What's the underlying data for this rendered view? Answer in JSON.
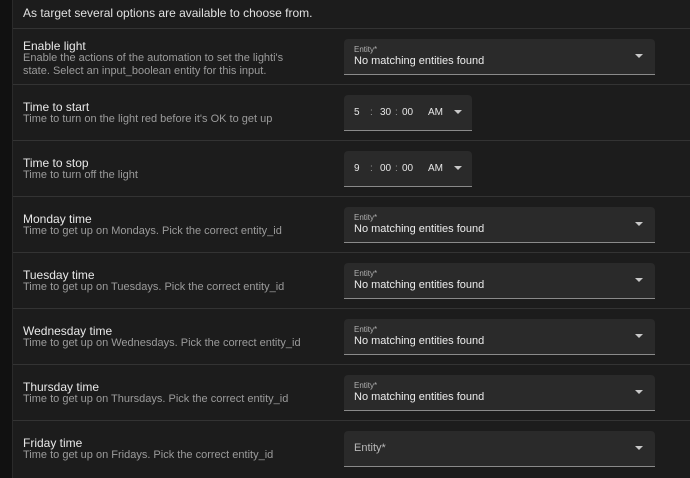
{
  "intro_text": "As target several options are available to choose from.",
  "rows": [
    {
      "title": "Enable light",
      "desc": "Enable the actions of the automation to set the lighti's state. Select an input_boolean entity for this input.",
      "type": "entity",
      "entity_label": "Entity*",
      "entity_value": "No matching entities found"
    },
    {
      "title": "Time to start",
      "desc": "Time to turn on the light red before it's OK to get up",
      "type": "time",
      "hour": "5",
      "minute": "30",
      "second": "00",
      "ampm": "AM"
    },
    {
      "title": "Time to stop",
      "desc": "Time to turn off the light",
      "type": "time",
      "hour": "9",
      "minute": "00",
      "second": "00",
      "ampm": "AM"
    },
    {
      "title": "Monday time",
      "desc": "Time to get up on Mondays. Pick the correct entity_id",
      "type": "entity",
      "entity_label": "Entity*",
      "entity_value": "No matching entities found"
    },
    {
      "title": "Tuesday time",
      "desc": "Time to get up on Tuesdays. Pick the correct entity_id",
      "type": "entity",
      "entity_label": "Entity*",
      "entity_value": "No matching entities found"
    },
    {
      "title": "Wednesday time",
      "desc": "Time to get up on Wednesdays. Pick the correct entity_id",
      "type": "entity",
      "entity_label": "Entity*",
      "entity_value": "No matching entities found"
    },
    {
      "title": "Thursday time",
      "desc": "Time to get up on Thursdays. Pick the correct entity_id",
      "type": "entity",
      "entity_label": "Entity*",
      "entity_value": "No matching entities found"
    },
    {
      "title": "Friday time",
      "desc": "Time to get up on Fridays. Pick the correct entity_id",
      "type": "entity-empty",
      "entity_label": "Entity*"
    }
  ],
  "time_separator": ":"
}
